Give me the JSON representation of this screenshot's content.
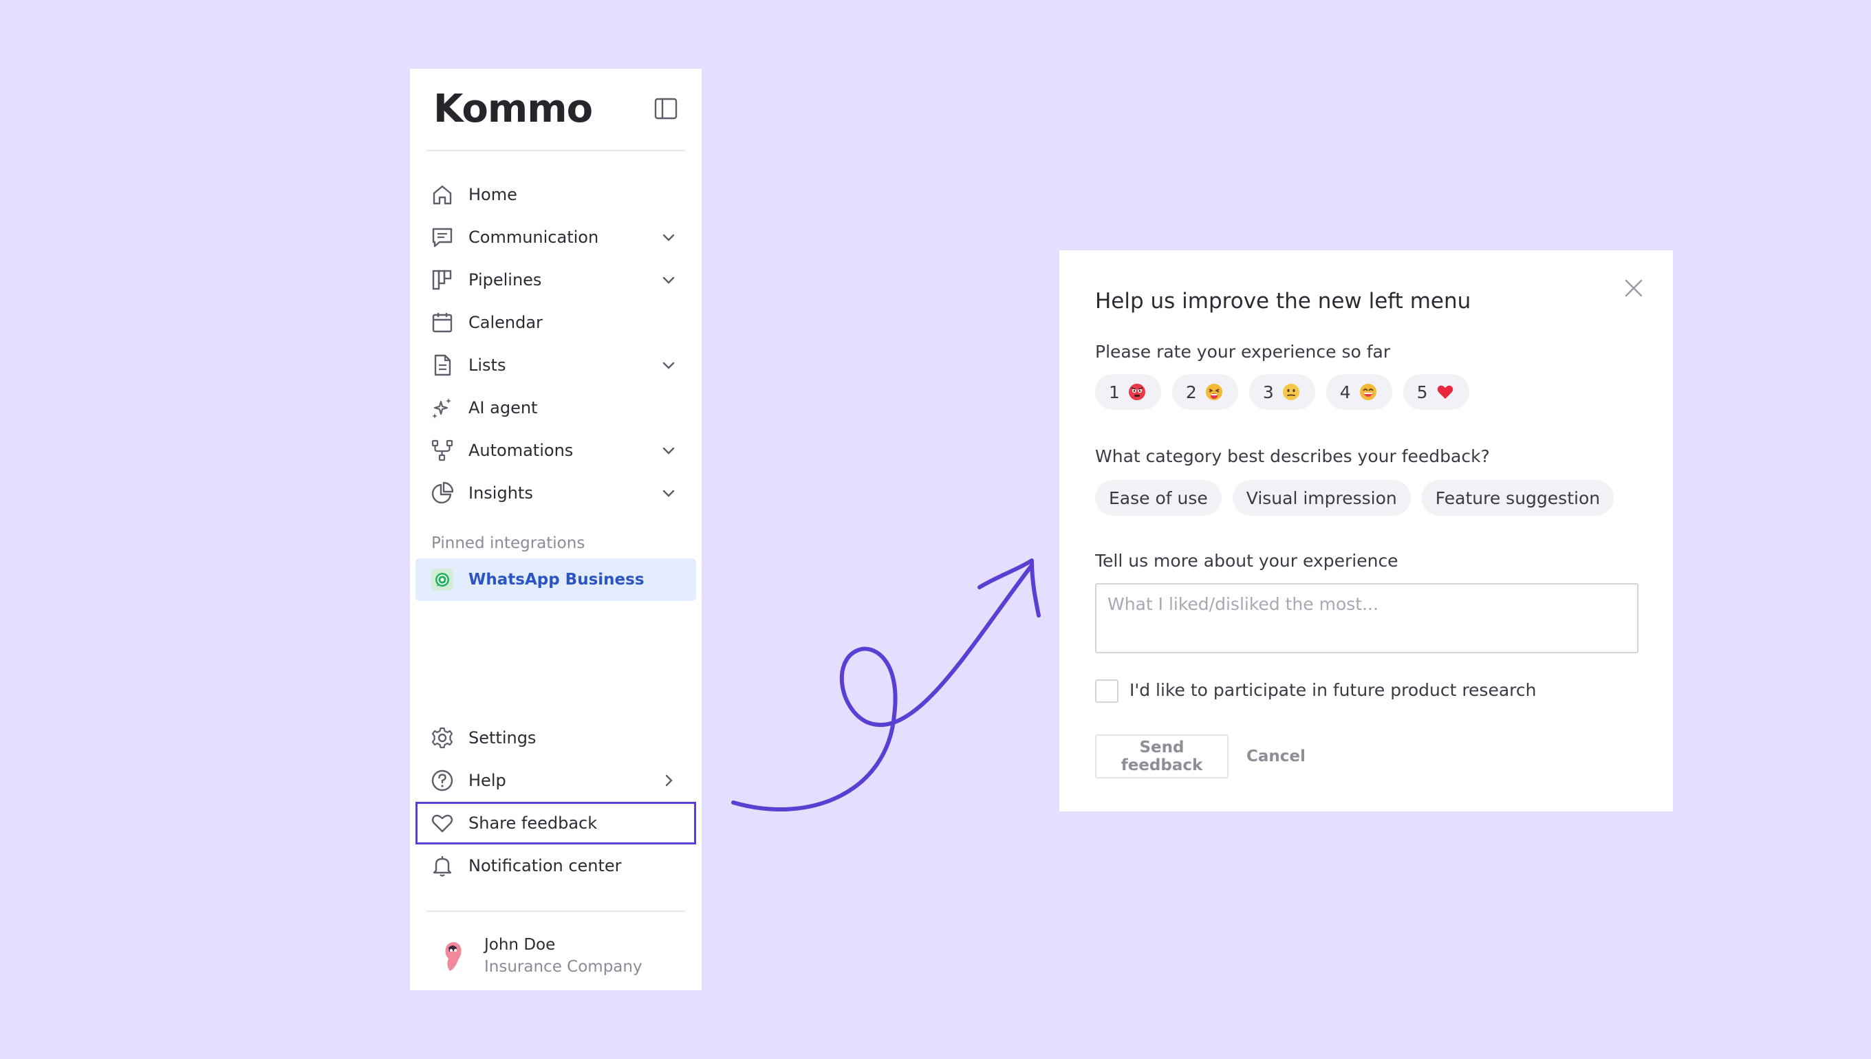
{
  "brand": {
    "logo_text": "Kommo",
    "accent_color": "#5b3fd2",
    "background_color": "#e4deff"
  },
  "sidebar": {
    "collapse_icon": "sidebar-collapse-icon",
    "items": [
      {
        "label": "Home",
        "icon": "home-icon",
        "has_chevron": false
      },
      {
        "label": "Communication",
        "icon": "chat-icon",
        "has_chevron": true
      },
      {
        "label": "Pipelines",
        "icon": "pipeline-icon",
        "has_chevron": true
      },
      {
        "label": "Calendar",
        "icon": "calendar-icon",
        "has_chevron": false
      },
      {
        "label": "Lists",
        "icon": "document-icon",
        "has_chevron": true
      },
      {
        "label": "AI agent",
        "icon": "sparkle-icon",
        "has_chevron": false
      },
      {
        "label": "Automations",
        "icon": "automation-icon",
        "has_chevron": true
      },
      {
        "label": "Insights",
        "icon": "pie-chart-icon",
        "has_chevron": true
      }
    ],
    "pinned_label": "Pinned integrations",
    "pinned": [
      {
        "label": "WhatsApp Business",
        "icon": "whatsapp-icon",
        "active": true
      }
    ],
    "bottom_items": [
      {
        "label": "Settings",
        "icon": "gear-icon"
      },
      {
        "label": "Help",
        "icon": "help-icon"
      },
      {
        "label": "Share feedback",
        "icon": "heart-icon",
        "highlighted": true
      },
      {
        "label": "Notification center",
        "icon": "bell-icon"
      }
    ],
    "user": {
      "name": "John Doe",
      "company": "Insurance Company"
    }
  },
  "dialog": {
    "title": "Help us improve the new left menu",
    "rating_question": "Please rate your experience so far",
    "ratings": [
      {
        "value": "1",
        "emoji": "angry-face-icon"
      },
      {
        "value": "2",
        "emoji": "tired-face-icon"
      },
      {
        "value": "3",
        "emoji": "neutral-face-icon"
      },
      {
        "value": "4",
        "emoji": "grinning-face-icon"
      },
      {
        "value": "5",
        "emoji": "red-heart-icon"
      }
    ],
    "category_question": "What category best describes your feedback?",
    "categories": [
      "Ease of use",
      "Visual impression",
      "Feature suggestion"
    ],
    "details_question": "Tell us more about your experience",
    "details_placeholder": "What I liked/disliked the most...",
    "details_value": "",
    "research_checkbox_label": "I'd like to participate in future product research",
    "research_checked": false,
    "send_label": "Send feedback",
    "cancel_label": "Cancel"
  }
}
